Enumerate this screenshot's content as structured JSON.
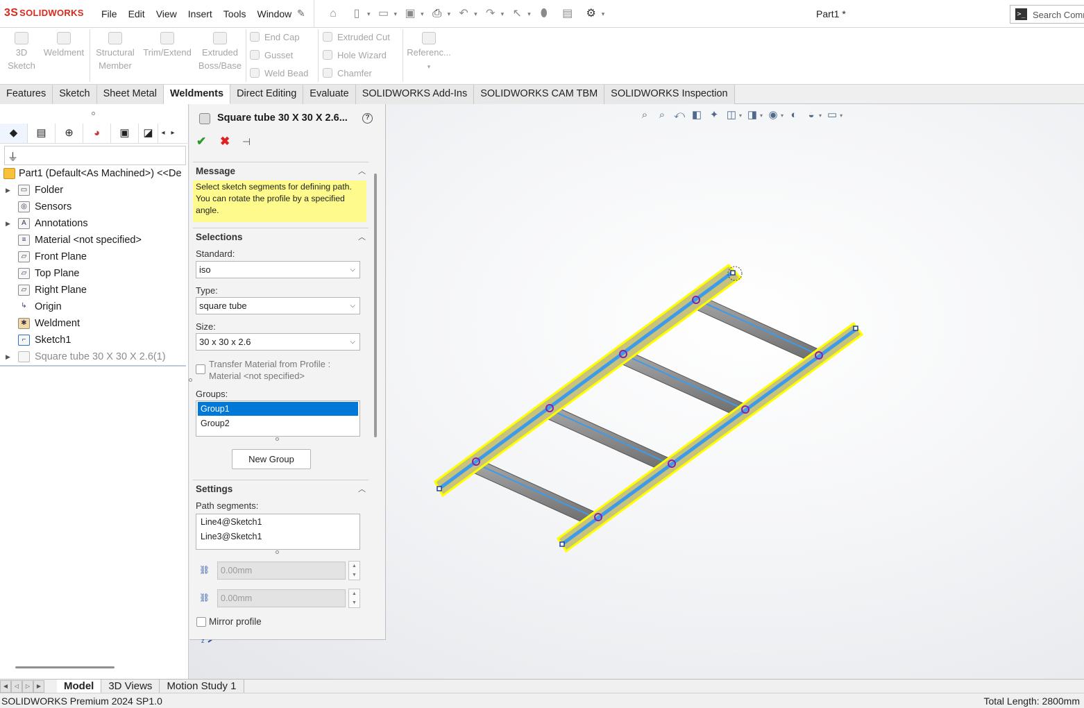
{
  "app": {
    "brand_mark": "3S",
    "brand": "SOLIDWORKS",
    "doc_title": "Part1 *",
    "search_placeholder": "Search Comr"
  },
  "menu": [
    "File",
    "Edit",
    "View",
    "Insert",
    "Tools",
    "Window"
  ],
  "ribbon": {
    "sketch3d": {
      "line1": "3D",
      "line2": "Sketch"
    },
    "weldment": "Weldment",
    "structural": {
      "line1": "Structural",
      "line2": "Member"
    },
    "trim": "Trim/Extend",
    "extruded": {
      "line1": "Extruded",
      "line2": "Boss/Base"
    },
    "endcap": "End Cap",
    "gusset": "Gusset",
    "weldbead": "Weld Bead",
    "extcut": "Extruded Cut",
    "holewizard": "Hole Wizard",
    "chamfer": "Chamfer",
    "reference": "Referenc..."
  },
  "tabs": [
    {
      "label": "Features",
      "active": false
    },
    {
      "label": "Sketch",
      "active": false
    },
    {
      "label": "Sheet Metal",
      "active": false
    },
    {
      "label": "Weldments",
      "active": true
    },
    {
      "label": "Direct Editing",
      "active": false
    },
    {
      "label": "Evaluate",
      "active": false
    },
    {
      "label": "SOLIDWORKS Add-Ins",
      "active": false
    },
    {
      "label": "SOLIDWORKS CAM TBM",
      "active": false
    },
    {
      "label": "SOLIDWORKS Inspection",
      "active": false
    }
  ],
  "tree": {
    "root": "Part1 (Default<As Machined>) <<De",
    "items": [
      {
        "label": "Folder",
        "icon": "folder-icon",
        "expandable": true
      },
      {
        "label": "Sensors",
        "icon": "sensors-icon",
        "expandable": false
      },
      {
        "label": "Annotations",
        "icon": "annotations-icon",
        "expandable": true
      },
      {
        "label": "Material <not specified>",
        "icon": "material-icon",
        "expandable": false
      },
      {
        "label": "Front Plane",
        "icon": "plane-icon",
        "expandable": false
      },
      {
        "label": "Top Plane",
        "icon": "plane-icon",
        "expandable": false
      },
      {
        "label": "Right Plane",
        "icon": "plane-icon",
        "expandable": false
      },
      {
        "label": "Origin",
        "icon": "origin-icon",
        "expandable": false
      },
      {
        "label": "Weldment",
        "icon": "weldment-icon",
        "expandable": false
      },
      {
        "label": "Sketch1",
        "icon": "sketch-icon",
        "expandable": false
      },
      {
        "label": "Square tube 30 X 30 X 2.6(1)",
        "icon": "structural-member-icon",
        "expandable": true,
        "greyed": true
      }
    ]
  },
  "pm": {
    "title": "Square tube 30 X 30 X 2.6...",
    "help": "?",
    "message": {
      "header": "Message",
      "text": "Select sketch segments for defining path. You can rotate the profile by a specified angle."
    },
    "selections": {
      "header": "Selections",
      "standard_label": "Standard:",
      "standard_value": "iso",
      "type_label": "Type:",
      "type_value": "square tube",
      "size_label": "Size:",
      "size_value": "30 x 30 x 2.6",
      "transfer_line1": "Transfer Material from Profile :",
      "transfer_line2": "Material <not specified>",
      "transfer_checked": false,
      "groups_label": "Groups:",
      "groups": [
        {
          "label": "Group1",
          "selected": true
        },
        {
          "label": "Group2",
          "selected": false
        }
      ],
      "new_group": "New Group"
    },
    "settings": {
      "header": "Settings",
      "path_label": "Path segments:",
      "paths": [
        "Line4@Sketch1",
        "Line3@Sketch1"
      ],
      "gap1": "0.00mm",
      "gap2": "0.00mm",
      "mirror_label": "Mirror profile",
      "mirror_checked": false
    }
  },
  "bottom_tabs": [
    {
      "label": "Model",
      "active": true
    },
    {
      "label": "3D Views",
      "active": false
    },
    {
      "label": "Motion Study 1",
      "active": false
    }
  ],
  "status": {
    "left": "SOLIDWORKS Premium 2024 SP1.0",
    "right": "Total Length: 2800mm"
  },
  "colors": {
    "brand": "#da291c",
    "selection_highlight": "#ffff00",
    "path_blue": "#3d9be9",
    "tube_grey": "#8c8c8c",
    "list_selected": "#0078d7",
    "message_bg": "#fefb8c"
  }
}
